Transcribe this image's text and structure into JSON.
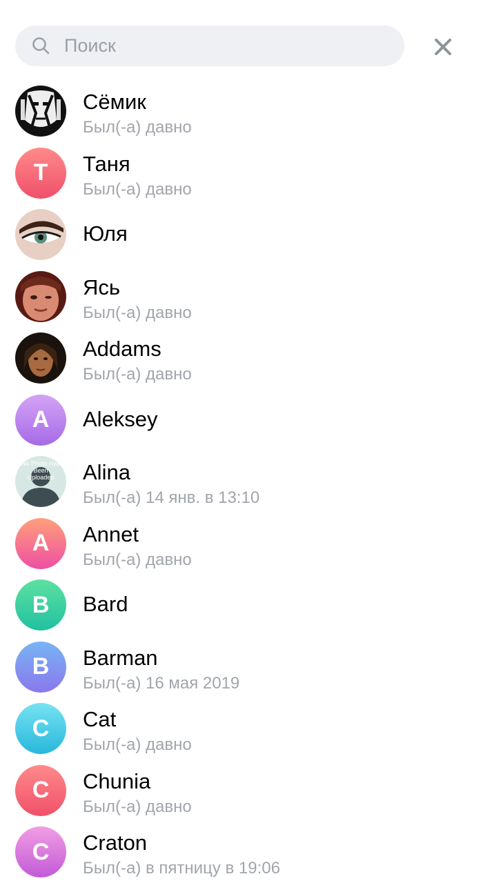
{
  "search": {
    "placeholder": "Поиск"
  },
  "close": {
    "icon": "close-icon"
  },
  "colors": {
    "red": [
      "#ff8a8a",
      "#f0506a"
    ],
    "purple": [
      "#d4a4f6",
      "#a66ae6"
    ],
    "pink": [
      "#ffa07a",
      "#ee4fa3"
    ],
    "green": [
      "#5de1a0",
      "#21c1a0"
    ],
    "blue": [
      "#78b4f4",
      "#8a78ec"
    ],
    "cyan": [
      "#76e3f3",
      "#28b7db"
    ],
    "magenta": [
      "#f19ee4",
      "#c35ad8"
    ]
  },
  "contacts": [
    {
      "name": "Сёмик",
      "status": "Был(-а) давно",
      "avatar": "photo-bw"
    },
    {
      "name": "Таня",
      "status": "Был(-а) давно",
      "initial": "Т",
      "color": "red"
    },
    {
      "name": "Юля",
      "avatar": "photo-eye"
    },
    {
      "name": "Ясь",
      "status": "Был(-а) давно",
      "avatar": "photo-red"
    },
    {
      "name": "Addams",
      "status": "Был(-а) давно",
      "avatar": "photo-dark"
    },
    {
      "name": "Aleksey",
      "initial": "A",
      "color": "purple"
    },
    {
      "name": "Alina",
      "status": "Был(-а) 14 янв. в 13:10",
      "avatar": "photo-nophoto",
      "avatar_text": "No Photo Has Been Uploaded"
    },
    {
      "name": "Annet",
      "status": "Был(-а) давно",
      "initial": "A",
      "color": "pink"
    },
    {
      "name": "Bard",
      "initial": "B",
      "color": "green"
    },
    {
      "name": "Barman",
      "status": "Был(-а) 16 мая 2019",
      "initial": "B",
      "color": "blue"
    },
    {
      "name": "Cat",
      "status": "Был(-а) давно",
      "initial": "C",
      "color": "cyan"
    },
    {
      "name": "Chunia",
      "status": "Был(-а) давно",
      "initial": "C",
      "color": "red"
    },
    {
      "name": "Craton",
      "status": "Был(-а) в пятницу в 19:06",
      "initial": "C",
      "color": "magenta"
    }
  ]
}
